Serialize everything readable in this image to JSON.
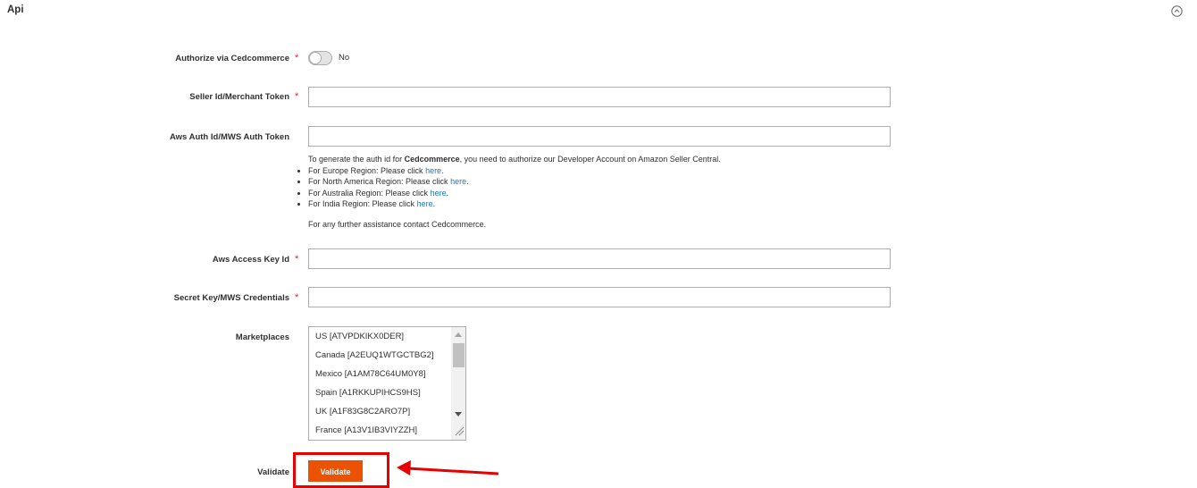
{
  "section": {
    "title": "Api"
  },
  "fields": {
    "authorize": {
      "label": "Authorize via Cedcommerce",
      "required": "*",
      "toggle_text": "No",
      "toggle_on": false
    },
    "seller_id": {
      "label": "Seller Id/Merchant Token",
      "required": "*",
      "value": ""
    },
    "aws_auth": {
      "label": "Aws Auth Id/MWS Auth Token",
      "value": ""
    },
    "access_key": {
      "label": "Aws Access Key Id",
      "required": "*",
      "value": ""
    },
    "secret_key": {
      "label": "Secret Key/MWS Credentials",
      "required": "*",
      "value": ""
    },
    "marketplaces": {
      "label": "Marketplaces",
      "options": [
        "US [ATVPDKIKX0DER]",
        "Canada [A2EUQ1WTGCTBG2]",
        "Mexico [A1AM78C64UM0Y8]",
        "Spain [A1RKKUPIHCS9HS]",
        "UK [A1F83G8C2ARO7P]",
        "France [A13V1IB3VIYZZH]"
      ]
    },
    "validate": {
      "label": "Validate",
      "button_label": "Validate"
    }
  },
  "note": {
    "intro_prefix": "To generate the auth id for ",
    "intro_bold": "Cedcommerce",
    "intro_suffix": ", you need to authorize our Developer Account on Amazon Seller Central.",
    "regions": [
      {
        "text": "For Europe Region: Please click ",
        "link": "here",
        "end": "."
      },
      {
        "text": "For North America Region: Please click ",
        "link": "here",
        "end": "."
      },
      {
        "text": "For Australia Region: Please click ",
        "link": "here",
        "end": "."
      },
      {
        "text": "For India Region: Please click ",
        "link": "here",
        "end": "."
      }
    ],
    "further": "For any further assistance contact Cedcommerce."
  },
  "colors": {
    "accent": "#eb5202",
    "required": "#e22626",
    "link": "#1979c3",
    "annotation": "#e60000"
  },
  "icons": {
    "collapse": "chevron-up-circle-icon"
  }
}
